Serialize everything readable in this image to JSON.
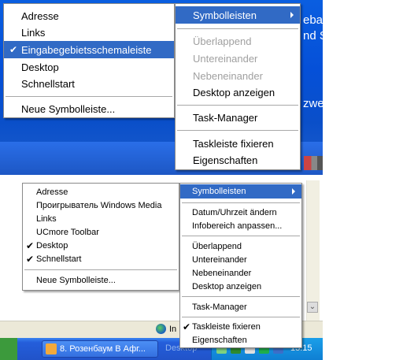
{
  "screenshot1": {
    "left_menu": {
      "items": [
        {
          "label": "Adresse",
          "checked": false,
          "selected": false
        },
        {
          "label": "Links",
          "checked": false,
          "selected": false
        },
        {
          "label": "Eingabegebietsschemaleiste",
          "checked": true,
          "selected": true
        },
        {
          "label": "Desktop",
          "checked": false,
          "selected": false
        },
        {
          "label": "Schnellstart",
          "checked": false,
          "selected": false
        }
      ],
      "new_toolbar": "Neue Symbolleiste..."
    },
    "right_menu": {
      "toolbars": "Symbolleisten",
      "cascade": "Überlappend",
      "tile_horizontal": "Untereinander",
      "tile_vertical": "Nebeneinander",
      "show_desktop": "Desktop anzeigen",
      "task_manager": "Task-Manager",
      "lock_taskbar": "Taskleiste fixieren",
      "properties": "Eigenschaften"
    },
    "background_text": [
      "ebar",
      "nd S",
      "zwei"
    ]
  },
  "screenshot2": {
    "left_menu": {
      "items": [
        {
          "label": "Adresse",
          "checked": false
        },
        {
          "label": "Проигрыватель Windows Media",
          "checked": false
        },
        {
          "label": "Links",
          "checked": false
        },
        {
          "label": "UCmore Toolbar",
          "checked": false
        },
        {
          "label": "Desktop",
          "checked": true
        },
        {
          "label": "Schnellstart",
          "checked": true
        }
      ],
      "new_toolbar": "Neue Symbolleiste..."
    },
    "right_menu": {
      "toolbars": "Symbolleisten",
      "date_time": "Datum/Uhrzeit ändern",
      "customize_notifications": "Infobereich anpassen...",
      "cascade": "Überlappend",
      "tile_horizontal": "Untereinander",
      "tile_vertical": "Nebeneinander",
      "show_desktop": "Desktop anzeigen",
      "task_manager": "Task-Manager",
      "lock_taskbar": "Taskleiste fixieren",
      "lock_taskbar_checked": true,
      "properties": "Eigenschaften"
    },
    "status_bar": {
      "zone_text": "In"
    },
    "taskbar": {
      "task_button": "8. Розенбаум В Афг...",
      "desktop_label": "Desktop",
      "clock": "13:15"
    }
  },
  "colors": {
    "menu_highlight": "#316ac5",
    "disabled_text": "#a0a0a0",
    "desktop_blue": "#0a5ee0",
    "taskbar_blue": "#245edb",
    "tray_blue": "#0f7fd3"
  }
}
